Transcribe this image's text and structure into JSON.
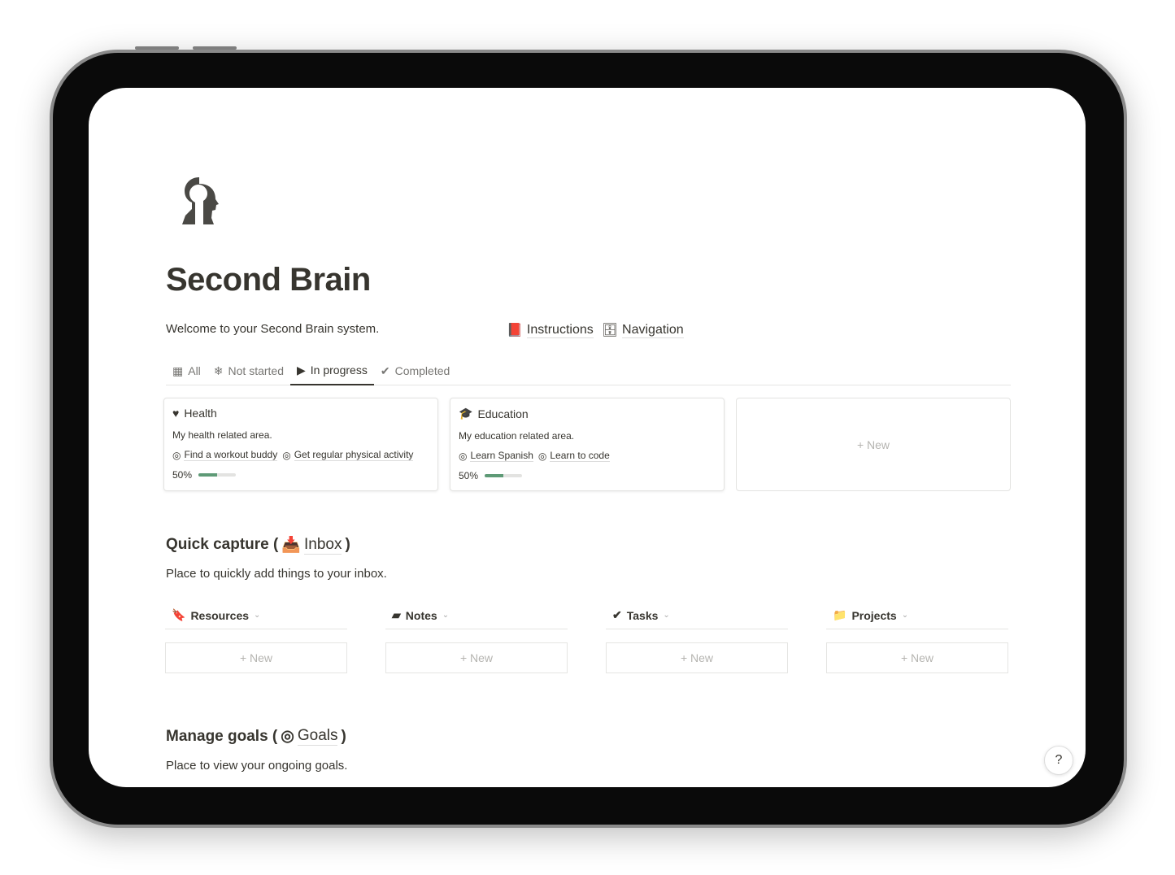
{
  "page": {
    "title": "Second Brain",
    "welcome": "Welcome to your Second Brain system.",
    "links": [
      {
        "label": "Instructions",
        "icon": "book-arrow-icon"
      },
      {
        "label": "Navigation",
        "icon": "database-arrow-icon"
      }
    ]
  },
  "tabs": [
    {
      "label": "All",
      "icon": "grid-icon"
    },
    {
      "label": "Not started",
      "icon": "snowflake-icon"
    },
    {
      "label": "In progress",
      "icon": "play-icon",
      "active": true
    },
    {
      "label": "Completed",
      "icon": "check-circle-icon"
    }
  ],
  "areas": [
    {
      "title": "Health",
      "icon": "heart-icon",
      "description": "My health related area.",
      "goals": [
        "Find a workout buddy",
        "Get regular physical activity"
      ],
      "progress_label": "50%",
      "progress": 0.5
    },
    {
      "title": "Education",
      "icon": "graduation-cap-icon",
      "description": "My education related area.",
      "goals": [
        "Learn Spanish",
        "Learn to code"
      ],
      "progress_label": "50%",
      "progress": 0.5
    }
  ],
  "new_label": "New",
  "quick_capture": {
    "heading": "Quick capture (",
    "ref": "Inbox",
    "close": ")",
    "description": "Place to quickly add things to your inbox.",
    "columns": [
      {
        "label": "Resources",
        "icon": "bookmark-icon"
      },
      {
        "label": "Notes",
        "icon": "note-icon"
      },
      {
        "label": "Tasks",
        "icon": "check-circle-icon"
      },
      {
        "label": "Projects",
        "icon": "folder-icon"
      }
    ]
  },
  "goals_section": {
    "heading": "Manage goals (",
    "ref": "Goals",
    "close": ")",
    "description": "Place to view your ongoing goals."
  },
  "help": "?",
  "colors": {
    "progress": "#5e9a76",
    "text": "#37352f"
  }
}
